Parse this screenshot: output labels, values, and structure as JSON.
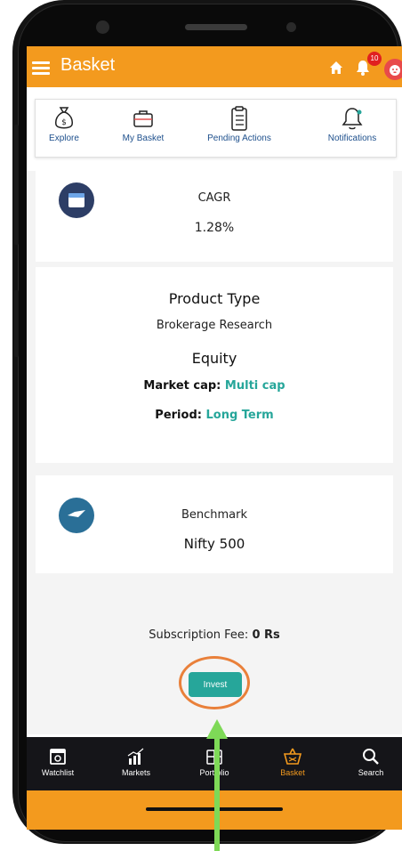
{
  "app_bar": {
    "title": "Basket",
    "notification_count": "10"
  },
  "top_tabs": [
    {
      "label": "Explore",
      "icon": "money-bag-icon"
    },
    {
      "label": "My Basket",
      "icon": "briefcase-icon"
    },
    {
      "label": "Pending Actions",
      "icon": "clipboard-icon"
    },
    {
      "label": "Notifications",
      "icon": "bell-icon"
    }
  ],
  "cagr": {
    "label": "CAGR",
    "value": "1.28%"
  },
  "product": {
    "title": "Product Type",
    "category": "Brokerage Research",
    "asset_class": "Equity",
    "market_cap_label": "Market cap:",
    "market_cap_value": "Multi cap",
    "period_label": "Period:",
    "period_value": "Long Term"
  },
  "benchmark": {
    "label": "Benchmark",
    "value": "Nifty 500"
  },
  "subscription": {
    "label": "Subscription Fee:",
    "value": "0 Rs"
  },
  "invest_label": "Invest",
  "bottom_nav": [
    {
      "label": "Watchlist",
      "icon": "watchlist-icon",
      "active": false
    },
    {
      "label": "Markets",
      "icon": "markets-chart-icon",
      "active": false
    },
    {
      "label": "Portfolio",
      "icon": "portfolio-icon",
      "active": false
    },
    {
      "label": "Basket",
      "icon": "basket-icon",
      "active": true
    },
    {
      "label": "Search",
      "icon": "search-icon",
      "active": false
    }
  ],
  "colors": {
    "brand_orange": "#f39a1e",
    "teal_accent": "#26a69a",
    "nav_dark": "#151519",
    "tab_text_blue": "#1d4f8c",
    "annotation_green": "#7ed957",
    "annotation_ring": "#e9803a"
  }
}
